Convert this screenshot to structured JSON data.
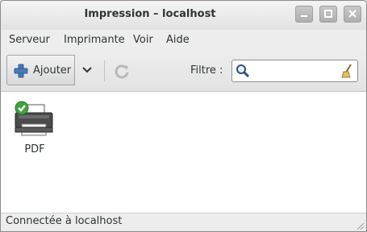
{
  "window": {
    "title": "Impression – localhost"
  },
  "menubar": {
    "items": [
      "Serveur",
      "Imprimante",
      "Voir",
      "Aide"
    ]
  },
  "toolbar": {
    "add_label": "Ajouter",
    "filter_label": "Filtre :",
    "filter_value": ""
  },
  "printers": [
    {
      "name": "PDF",
      "status": "default"
    }
  ],
  "status": {
    "text": "Connectée à localhost"
  }
}
